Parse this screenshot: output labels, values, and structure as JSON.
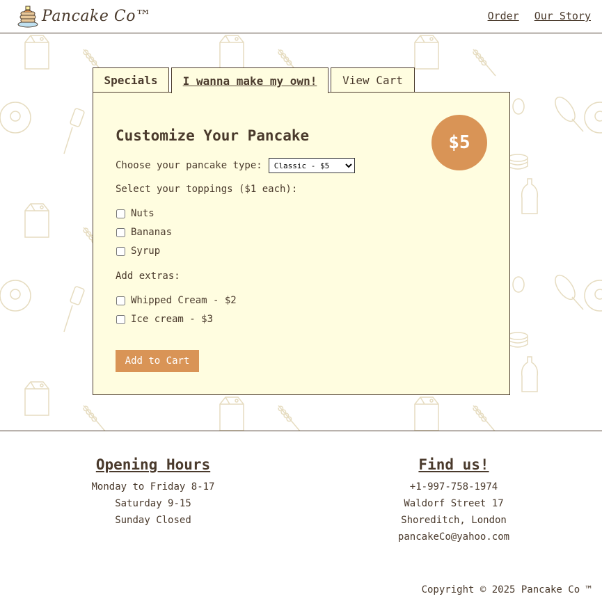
{
  "header": {
    "brand": "Pancake Co™",
    "nav": [
      {
        "label": "Order"
      },
      {
        "label": "Our Story"
      }
    ]
  },
  "tabs": [
    {
      "label": "Specials"
    },
    {
      "label": "I wanna make my own!"
    },
    {
      "label": "View Cart"
    }
  ],
  "customize": {
    "title": "Customize Your Pancake",
    "price": "$5",
    "type_label": "Choose your pancake type:",
    "type_selected": "Classic - $5",
    "toppings_label": "Select your toppings ($1 each):",
    "toppings": [
      "Nuts",
      "Bananas",
      "Syrup"
    ],
    "extras_label": "Add extras:",
    "extras": [
      "Whipped Cream - $2",
      "Ice cream - $3"
    ],
    "add_button": "Add to Cart"
  },
  "footer": {
    "hours_title": "Opening Hours",
    "hours": [
      "Monday to Friday 8-17",
      "Saturday 9-15",
      "Sunday Closed"
    ],
    "find_title": "Find us!",
    "contact": [
      "+1-997-758-1974",
      "Waldorf Street 17",
      "Shoreditch, London",
      "pancakeCo@yahoo.com"
    ],
    "copyright": "Copyright © 2025 Pancake Co ™"
  },
  "colors": {
    "accent": "#d99456",
    "panel_bg": "#fffde0",
    "text": "#4a3a2c",
    "pattern_stroke": "#e6dcc0"
  },
  "icons": [
    "pancake-stack-icon",
    "milk-carton-icon",
    "wheat-icon",
    "egg-icon",
    "spatula-icon",
    "whisk-icon",
    "syrup-bottle-icon"
  ]
}
